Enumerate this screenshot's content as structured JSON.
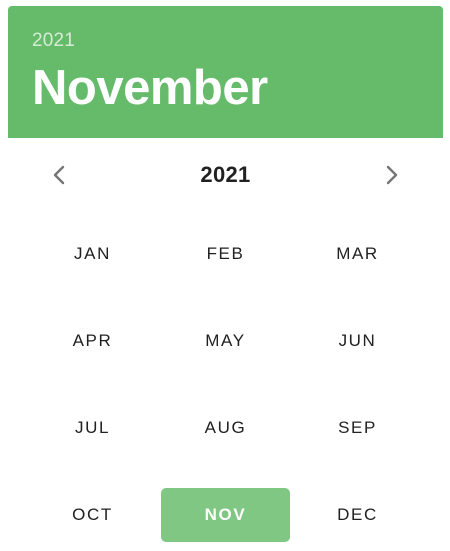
{
  "header": {
    "year": "2021",
    "month": "November"
  },
  "navigation": {
    "year": "2021",
    "prev_icon": "chevron-left-icon",
    "next_icon": "chevron-right-icon"
  },
  "months": [
    {
      "label": "JAN",
      "selected": false
    },
    {
      "label": "FEB",
      "selected": false
    },
    {
      "label": "MAR",
      "selected": false
    },
    {
      "label": "APR",
      "selected": false
    },
    {
      "label": "MAY",
      "selected": false
    },
    {
      "label": "JUN",
      "selected": false
    },
    {
      "label": "JUL",
      "selected": false
    },
    {
      "label": "AUG",
      "selected": false
    },
    {
      "label": "SEP",
      "selected": false
    },
    {
      "label": "OCT",
      "selected": false
    },
    {
      "label": "NOV",
      "selected": true
    },
    {
      "label": "DEC",
      "selected": false
    }
  ],
  "colors": {
    "header_background": "#66bb6a",
    "selected_background": "#81c784",
    "text": "#212121"
  }
}
